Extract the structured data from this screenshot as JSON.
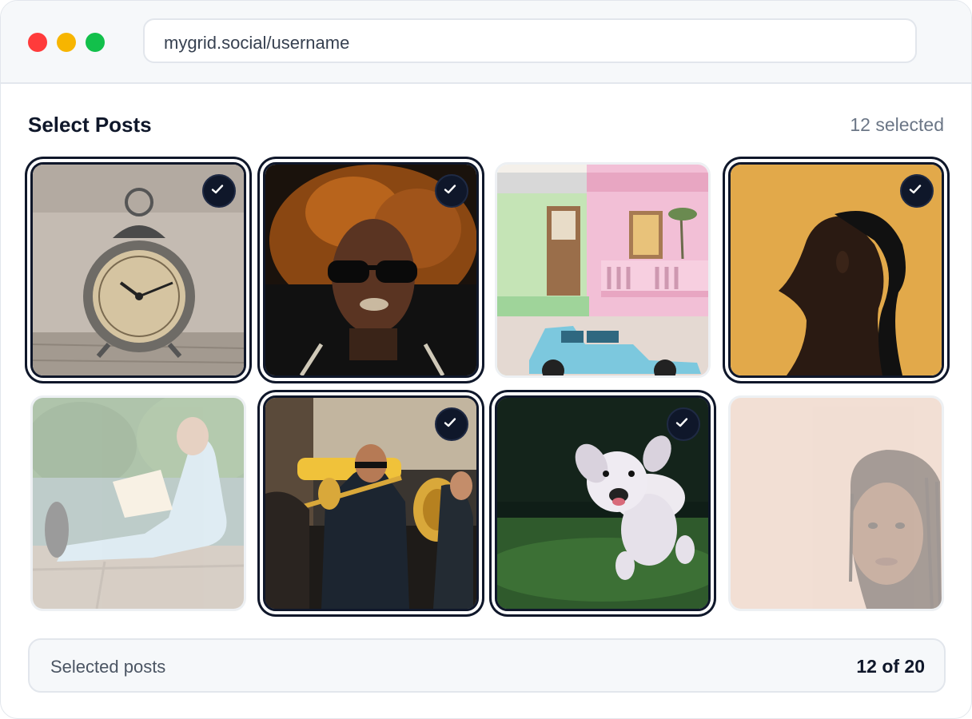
{
  "window": {
    "url": "mygrid.social/username"
  },
  "page": {
    "title": "Select Posts",
    "selected_count_label": "12 selected"
  },
  "posts": [
    {
      "subject": "alarm-clock",
      "selected": true
    },
    {
      "subject": "woman-sunglasses",
      "selected": true
    },
    {
      "subject": "pink-house-blue-car",
      "selected": false
    },
    {
      "subject": "woman-profile-ponytail",
      "selected": true
    },
    {
      "subject": "man-reading-by-lake",
      "selected": false
    },
    {
      "subject": "brass-band",
      "selected": true
    },
    {
      "subject": "running-dog",
      "selected": true
    },
    {
      "subject": "woman-braids-portrait",
      "selected": false
    }
  ],
  "footer": {
    "label": "Selected posts",
    "value": "12 of 20"
  },
  "icons": {
    "check": "checkmark-icon"
  },
  "colors": {
    "accent": "#0f172a",
    "close_dot": "#ff3b3b",
    "minimize_dot": "#f7b500",
    "maximize_dot": "#12c04b"
  }
}
